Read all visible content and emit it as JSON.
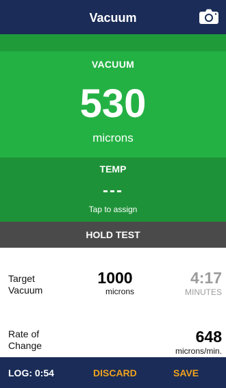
{
  "header": {
    "title": "Vacuum",
    "camera_icon": "camera-icon"
  },
  "vacuum": {
    "label": "VACUUM",
    "value": "530",
    "unit": "microns"
  },
  "temp": {
    "label": "TEMP",
    "value": "---",
    "hint": "Tap to assign"
  },
  "hold_test": {
    "label": "HOLD TEST"
  },
  "target": {
    "label_line1": "Target",
    "label_line2": "Vacuum",
    "value": "1000",
    "unit": "microns",
    "time_value": "4:17",
    "time_unit": "MINUTES"
  },
  "rate": {
    "label_line1": "Rate of",
    "label_line2": "Change",
    "value": "648",
    "unit": "microns/min."
  },
  "footer": {
    "log": "LOG: 0:54",
    "discard": "DISCARD",
    "save": "SAVE"
  },
  "colors": {
    "header_bg": "#1a2c57",
    "vacuum_green": "#24b144",
    "temp_green": "#1e9238",
    "hold_gray": "#4a4a4a",
    "accent_orange": "#f0a21c",
    "muted_gray": "#9c9c9c"
  }
}
